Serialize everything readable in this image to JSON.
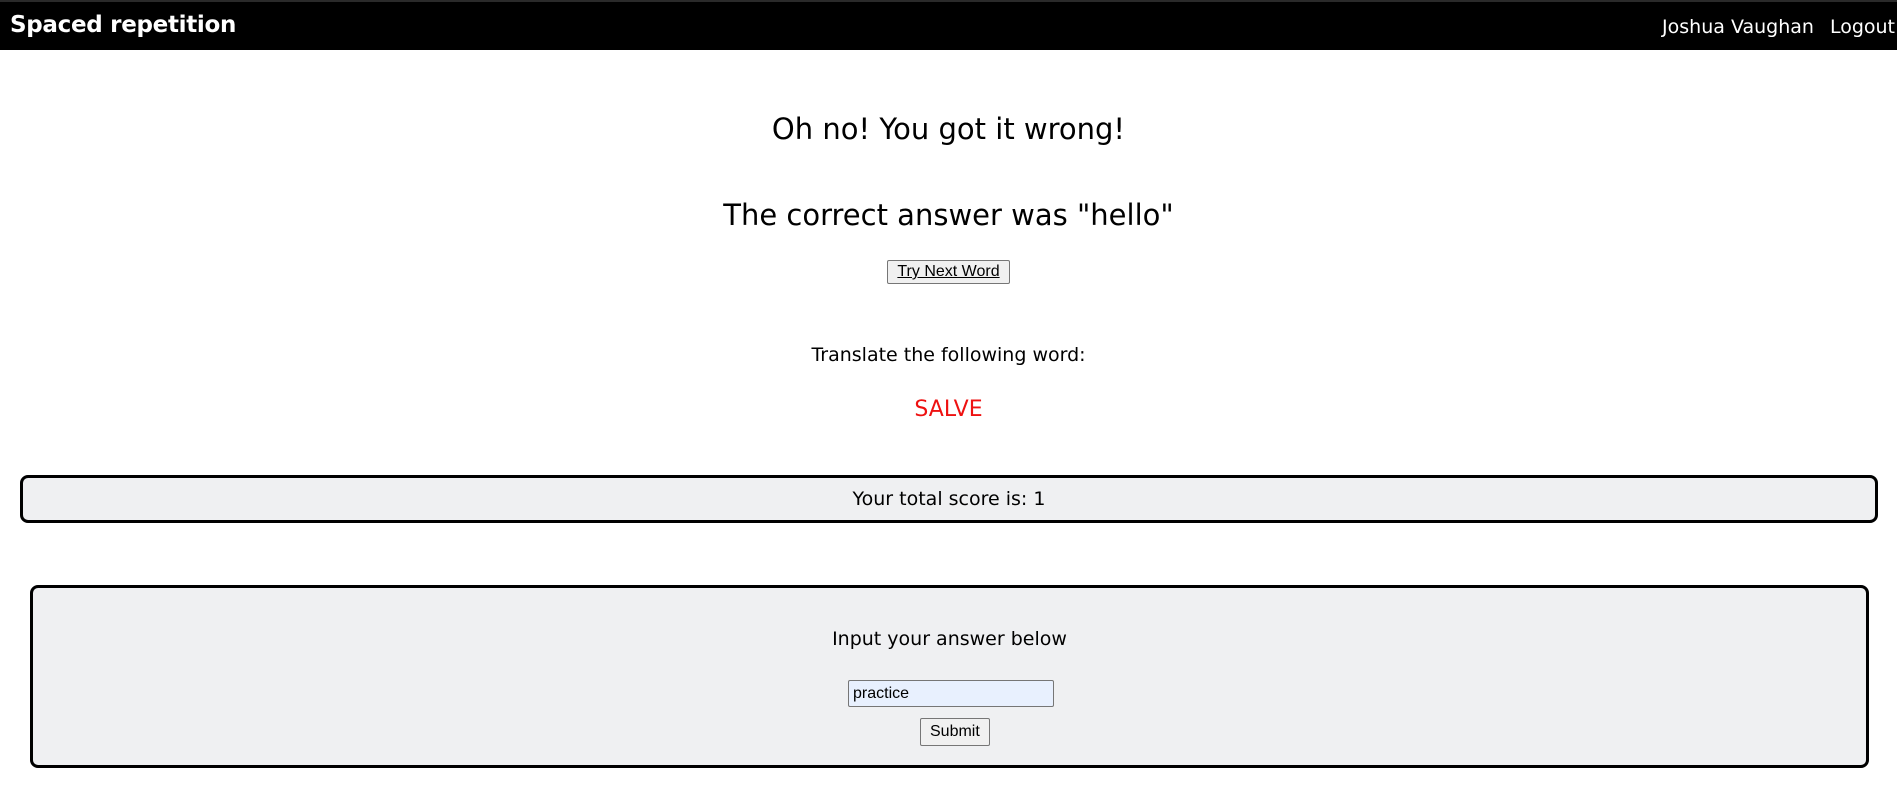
{
  "header": {
    "brand": "Spaced repetition",
    "user_name": "Joshua Vaughan",
    "logout_label": "Logout"
  },
  "feedback": {
    "title": "Oh no! You got it wrong!",
    "correct_answer_text": "The correct answer was \"hello\"",
    "next_button_label": "Try Next Word"
  },
  "prompt": {
    "instruction": "Translate the following word:",
    "word": "SALVE",
    "word_color": "#ee1111"
  },
  "score": {
    "text": "Your total score is: 1"
  },
  "answer_form": {
    "title": "Input your answer below",
    "input_value": "practice",
    "submit_label": "Submit"
  }
}
